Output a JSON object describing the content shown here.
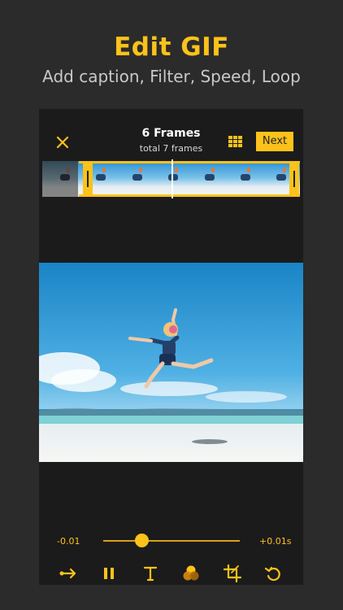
{
  "promo": {
    "title": "Edit GIF",
    "subtitle": "Add caption, Filter, Speed, Loop"
  },
  "header": {
    "frames_title": "6 Frames",
    "frames_subtitle": "total 7 frames",
    "next_label": "Next",
    "close_icon": "close-icon",
    "grid_icon": "grid-icon"
  },
  "timeline": {
    "total_frames": 7,
    "selected_frames": 6,
    "playhead_fraction": 0.42
  },
  "speed": {
    "min_label": "-0.01",
    "max_label": "+0.01s",
    "value_fraction": 0.28
  },
  "toolbar": {
    "items": [
      "loop-arrow-icon",
      "pause-icon",
      "text-icon",
      "filter-icon",
      "crop-icon",
      "undo-icon"
    ]
  },
  "colors": {
    "accent": "#ffc21a",
    "background": "#2b2b2b",
    "panel": "#1b1b1b"
  }
}
